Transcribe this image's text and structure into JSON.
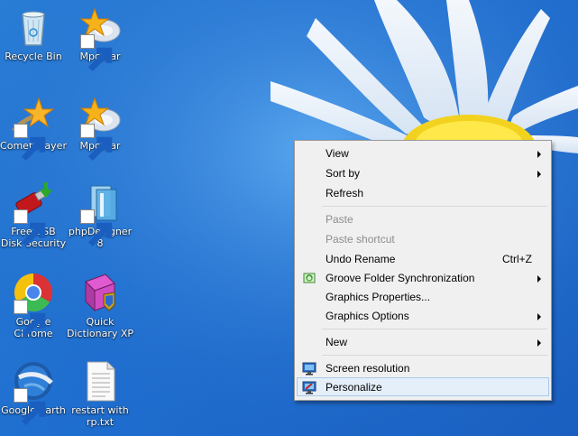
{
  "desktop": {
    "icons": [
      {
        "label": "Recycle Bin",
        "icon": "recycle-bin-icon"
      },
      {
        "label": "MpcStar",
        "icon": "mpcstar-icon"
      },
      {
        "label": "Comet Player",
        "icon": "comet-player-icon"
      },
      {
        "label": "MpcStar",
        "icon": "mpcstar-icon"
      },
      {
        "label": "Free USB Disk Security",
        "icon": "usb-disk-icon"
      },
      {
        "label": "phpDesigner 8",
        "icon": "phpdesigner-icon"
      },
      {
        "label": "Google Chrome",
        "icon": "chrome-icon"
      },
      {
        "label": "Quick Dictionary XP",
        "icon": "dictionary-icon"
      },
      {
        "label": "Google Earth",
        "icon": "google-earth-icon"
      },
      {
        "label": "restart with rp.txt",
        "icon": "text-file-icon"
      }
    ]
  },
  "context_menu": {
    "items": [
      {
        "label": "View"
      },
      {
        "label": "Sort by"
      },
      {
        "label": "Refresh"
      },
      {
        "label": "Paste"
      },
      {
        "label": "Paste shortcut"
      },
      {
        "label": "Undo Rename",
        "shortcut": "Ctrl+Z"
      },
      {
        "label": "Groove Folder Synchronization"
      },
      {
        "label": "Graphics Properties..."
      },
      {
        "label": "Graphics Options"
      },
      {
        "label": "New"
      },
      {
        "label": "Screen resolution"
      },
      {
        "label": "Personalize"
      }
    ]
  },
  "colors": {
    "wallpaper": "#1f6fd0",
    "menu_bg": "#f0f0f0",
    "menu_highlight": "#e5eff9",
    "menu_disabled_text": "#8d8d8d"
  }
}
